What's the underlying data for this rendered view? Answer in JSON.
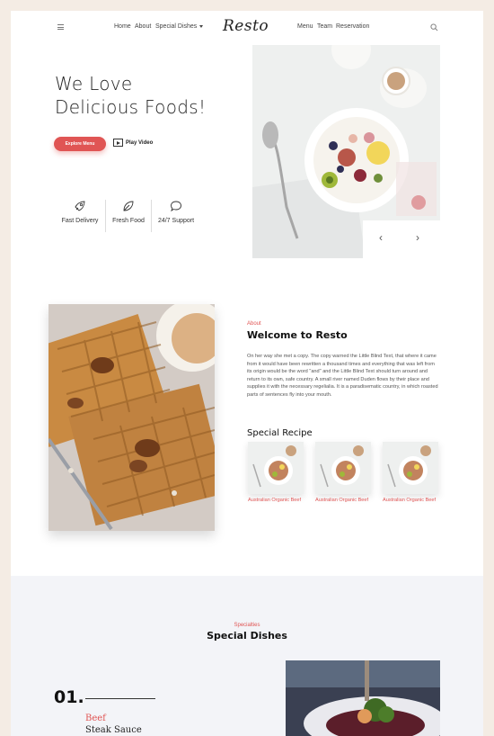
{
  "nav": {
    "links_left": [
      "Home",
      "About",
      "Special Dishes"
    ],
    "logo": "Resto",
    "links_right": [
      "Menu",
      "Team",
      "Reservation"
    ]
  },
  "hero": {
    "title_line1": "We Love",
    "title_line2": "Delicious Foods!",
    "explore_button": "Explore Menu",
    "play_video": "Play Video",
    "features": [
      "Fast Delivery",
      "Fresh Food",
      "24/7 Support"
    ]
  },
  "about": {
    "kicker": "About",
    "title": "Welcome to Resto",
    "text": "On her way she met a copy. The copy warned the Little Blind Text, that where it came from it would have been rewritten a thousand times and everything that was left from its origin would be the word \"and\" and the Little Blind Text should turn around and return to its own, safe country. A small river named Duden flows by their place and supplies it with the necessary regelialia. It is a paradisematic country, in which roasted parts of sentences fly into your mouth.",
    "recipe_title": "Special Recipe",
    "recipes": [
      "Australian Organic Beef",
      "Australian Organic Beef",
      "Australian Organic Beef"
    ]
  },
  "dishes": {
    "kicker": "Specialties",
    "title": "Special Dishes",
    "number": "01.",
    "category": "Beef",
    "name": "Steak Sauce"
  },
  "colors": {
    "accent": "#e05554",
    "frame": "#f4ece4",
    "band": "#f3f4f8"
  }
}
